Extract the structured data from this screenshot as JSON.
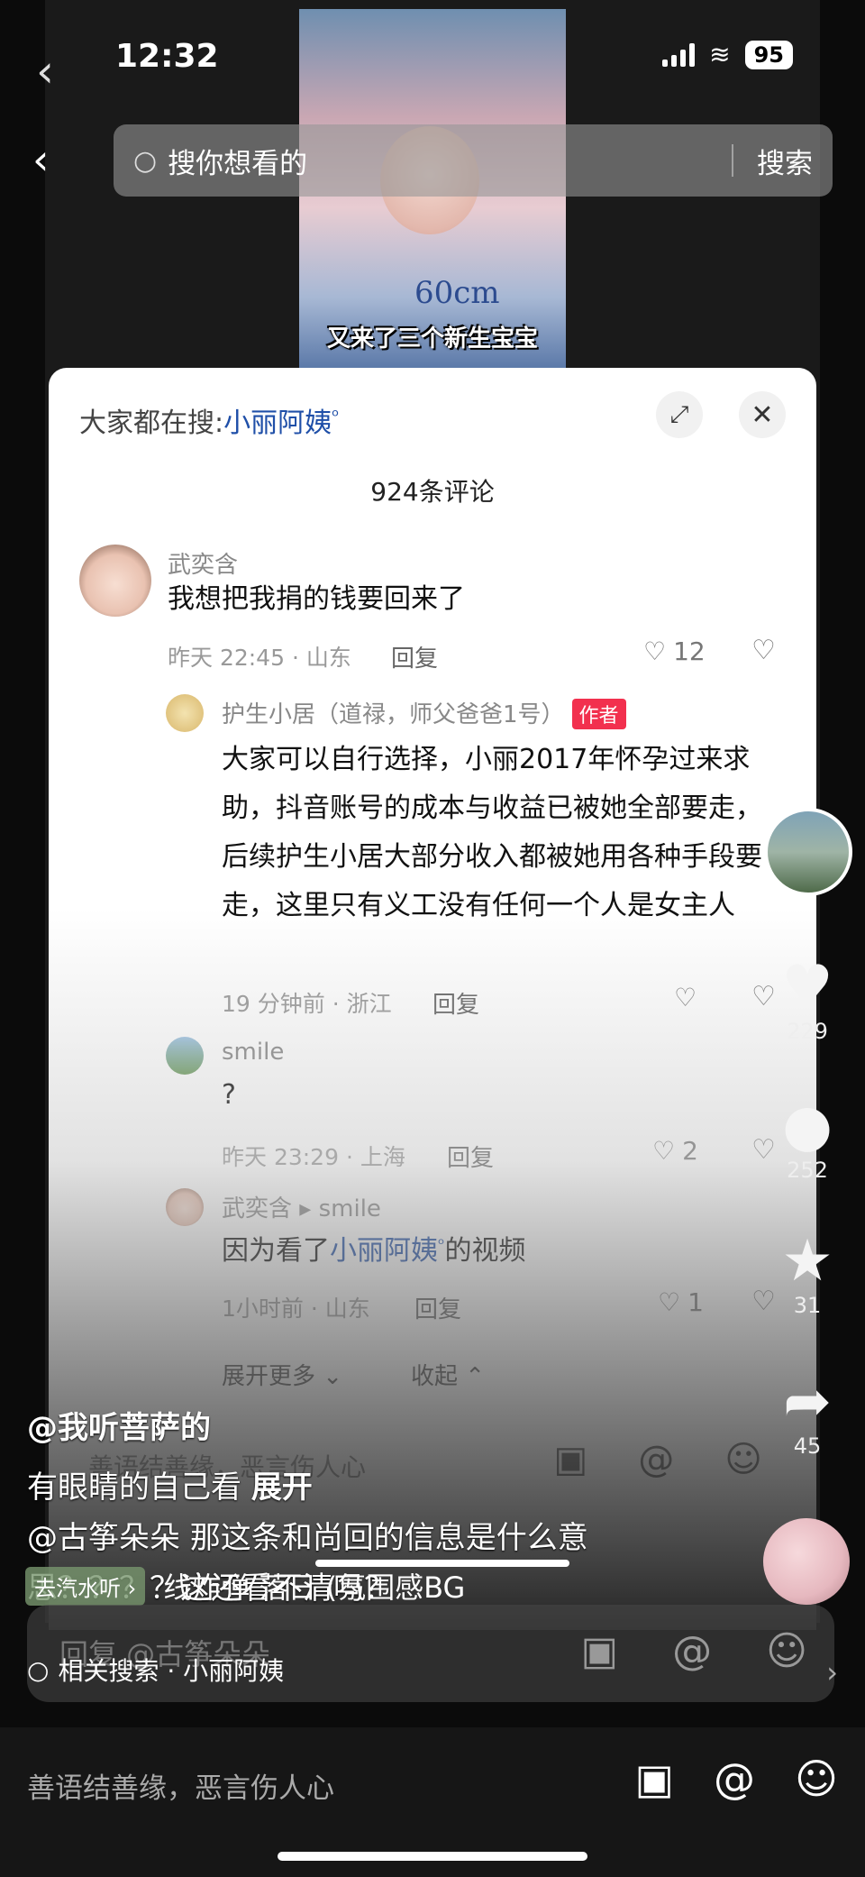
{
  "status": {
    "time": "12:32",
    "battery": "95"
  },
  "search": {
    "placeholder": "搜你想看的",
    "button": "搜索"
  },
  "video": {
    "caption": "又来了三个新生宝宝",
    "cm_mark": "60cm"
  },
  "panel": {
    "hot_search_prefix": "大家都在搜:",
    "hot_search_keyword": "小丽阿姨",
    "comment_count": "924条评论",
    "comments": [
      {
        "user": "武奕含",
        "text": "我想把我捐的钱要回来了",
        "meta": "昨天 22:45 · 山东",
        "reply": "回复",
        "likes": "12"
      },
      {
        "user": "护生小居（道禄，师父爸爸1号）",
        "badge": "作者",
        "text": "大家可以自行选择，小丽2017年怀孕过来求助，抖音账号的成本与收益已被她全部要走，后续护生小居大部分收入都被她用各种手段要走，这里只有义工没有任何一个人是女主人",
        "meta": "19 分钟前 · 浙江",
        "reply": "回复"
      },
      {
        "user": "smile",
        "text": "?",
        "meta": "昨天 23:29 · 上海",
        "reply": "回复",
        "likes": "2"
      },
      {
        "user": "武奕含",
        "reply_to": "smile",
        "text_before": "因为看了",
        "text_link": "小丽阿姨",
        "text_after": "的视频",
        "meta": "1小时前 · 山东",
        "reply": "回复",
        "likes": "1"
      }
    ],
    "expand_more": "展开更多",
    "collapse": "收起",
    "input_placeholder": "善语结善缘，恶言伤人心"
  },
  "rail": {
    "likes": "229",
    "comments": "252",
    "favorites": "31",
    "shares": "45"
  },
  "overlay": {
    "username": "@我听菩萨的",
    "desc_line1": "有眼睛的自己看",
    "expand": "展开",
    "desc_line2": "@古筝朵朵 那这条和尚回的信息是什么意思？？？？这还看不清吗？",
    "music_tag": "去汽水听",
    "music_text": "线炸弹  落日 (氛围感BG",
    "reply_placeholder": "回复 @古筝朵朵",
    "related_search": "相关搜索 · 小丽阿姨"
  },
  "bottom": {
    "placeholder": "善语结善缘，恶言伤人心"
  }
}
